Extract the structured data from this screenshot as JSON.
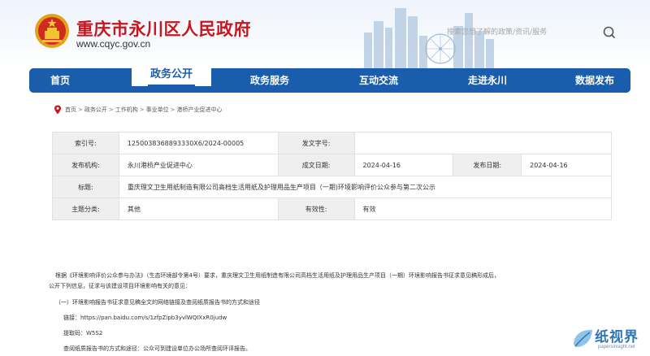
{
  "header": {
    "site_title": "重庆市永川区人民政府",
    "site_url": "www.cqyc.gov.cn",
    "search_placeholder": "搜索您想了解的政策/资讯/服务"
  },
  "nav": {
    "items": [
      "首页",
      "政务公开",
      "政务服务",
      "互动交流",
      "走进永川",
      "数据发布"
    ],
    "active": "政务公开"
  },
  "breadcrumb": [
    "首页",
    "政务公开",
    "工作机构",
    "事业单位",
    "港桥产业促进中心"
  ],
  "info": {
    "index_no_label": "索引号:",
    "index_no": "1250038368893330X6/2024-00005",
    "doc_no_label": "发文字号:",
    "doc_no": "",
    "org_label": "发布机构:",
    "org": "永川港桥产业促进中心",
    "created_label": "成文日期:",
    "created": "2024-04-16",
    "published_label": "发布日期:",
    "published": "2024-04-16",
    "title_label": "标题:",
    "title": "重庆理文卫生用纸制造有限公司高档生活用纸及护理用品生产项目（一期)环境影响评价公众参与第二次公示",
    "topic_label": "主题分类:",
    "topic": "其他",
    "validity_label": "有效性:",
    "validity": "有效"
  },
  "body": {
    "para1_line1": "根据《环境影响评价公众参与办法》（生态环境部令第4号）要求，重庆理文卫生用纸制造有限公司高档生活用纸及护理用品生产项目（一期）环境影响报告书征求意见稿形成后，",
    "para1_line2": "公开下列信息，征求与该建设项目环境影响有关的意见：",
    "item1": "（一）环境影响报告书征求意见稿全文的网络链接及查阅纸质报告书的方式和途径",
    "link": "链接：https://pan.baidu.com/s/1zfpZipb3yvlWQIXxR0judw",
    "code": "提取码：W5S2",
    "paper": "查阅纸质报告书的方式和途径：公众可到建设单位办公场所查阅环评报告。"
  },
  "watermark": {
    "text": "纸视界",
    "url": "papersinsight.net"
  },
  "colors": {
    "brand_red": "#c8161e",
    "nav_blue": "#1a5dac"
  }
}
